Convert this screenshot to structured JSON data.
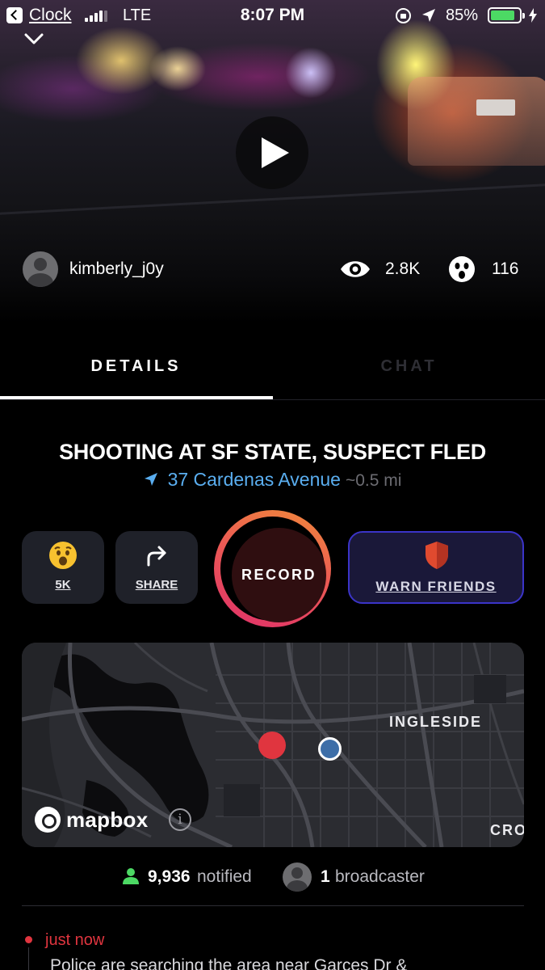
{
  "status_bar": {
    "back_app": "Clock",
    "carrier": "LTE",
    "time": "8:07 PM",
    "battery": "85%",
    "battery_level": 0.85
  },
  "video": {
    "username": "kimberly_j0y",
    "views": "2.8K",
    "reactions": "116"
  },
  "tabs": [
    {
      "label": "DETAILS",
      "active": true
    },
    {
      "label": "CHAT",
      "active": false
    }
  ],
  "incident": {
    "title": "SHOOTING AT SF STATE, SUSPECT FLED",
    "address": "37 Cardenas Avenue",
    "distance": "~0.5 mi"
  },
  "actions": {
    "reaction_count": "5K",
    "share_label": "SHARE",
    "record_label": "RECORD",
    "warn_label": "WARN FRIENDS"
  },
  "map": {
    "labels": [
      "INGLESIDE",
      "CRO"
    ],
    "attribution": "mapbox",
    "info_glyph": "i"
  },
  "stats": {
    "notified_count": "9,936",
    "notified_text": "notified",
    "broadcaster_count": "1",
    "broadcaster_text": "broadcaster"
  },
  "timeline": {
    "time": "just now",
    "text": "Police are searching the area near Garces Dr &"
  },
  "colors": {
    "accent_blue": "#5aaef0",
    "alert_red": "#e0353f",
    "warn_border": "#3b34c8",
    "green": "#4cd964"
  }
}
